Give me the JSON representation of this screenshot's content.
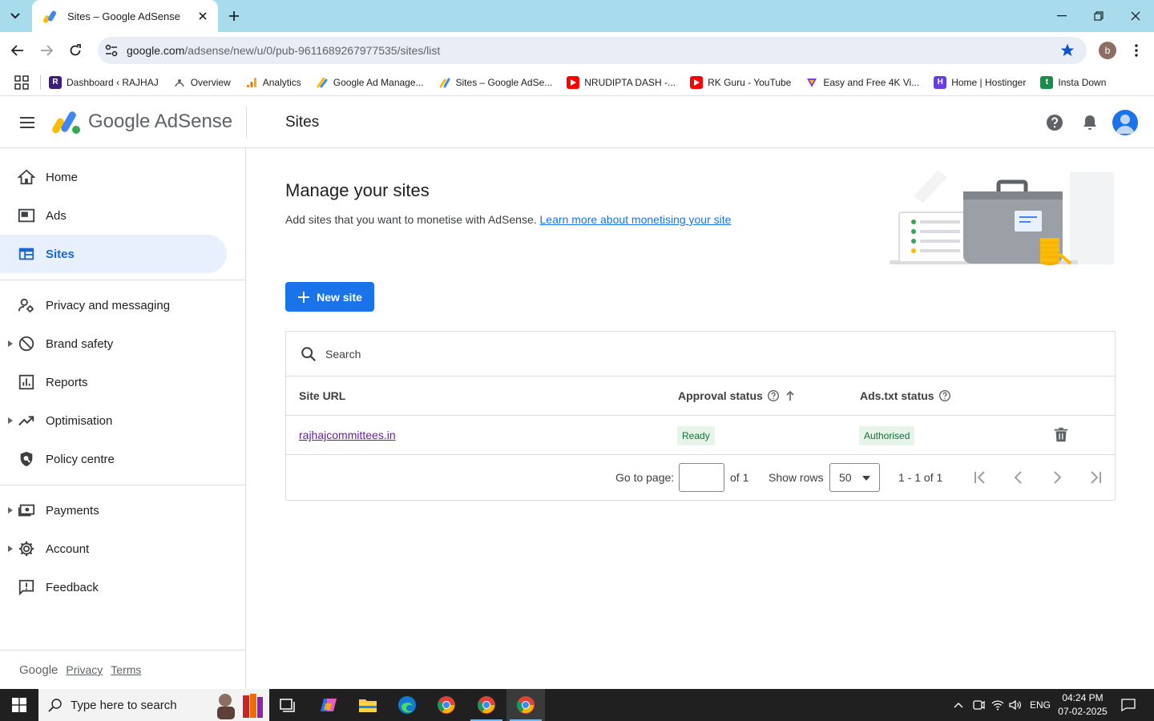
{
  "browser": {
    "tab_title": "Sites – Google AdSense",
    "url_host": "google.com",
    "url_path": "/adsense/new/u/0/pub-9611689267977535/sites/list",
    "profile_initial": "b"
  },
  "bookmarks": [
    {
      "label": "Dashboard ‹ RAJHAJ",
      "icon": "site-r-icon",
      "color": "#3c1f7a"
    },
    {
      "label": "Overview",
      "icon": "overview-icon",
      "color": "#5f6368"
    },
    {
      "label": "Analytics",
      "icon": "analytics-icon",
      "color": "#f9ab00"
    },
    {
      "label": "Google Ad Manage...",
      "icon": "ad-manager-icon",
      "color": "#fbbc04"
    },
    {
      "label": "Sites – Google AdSe...",
      "icon": "adsense-icon",
      "color": "#4285f4"
    },
    {
      "label": "NRUDIPTA DASH -...",
      "icon": "youtube-icon",
      "color": "#ff0000"
    },
    {
      "label": "RK Guru - YouTube",
      "icon": "youtube-icon",
      "color": "#ff0000"
    },
    {
      "label": "Easy and Free 4K Vi...",
      "icon": "vimeo-like-icon",
      "color": "#7b3fe4"
    },
    {
      "label": "Home | Hostinger",
      "icon": "hostinger-icon",
      "color": "#673de6"
    },
    {
      "label": "Insta Down",
      "icon": "insta-down-icon",
      "color": "#1b8a4c"
    }
  ],
  "header": {
    "product": "Google AdSense",
    "page_title": "Sites"
  },
  "sidebar": {
    "items": [
      {
        "label": "Home",
        "icon": "home-icon"
      },
      {
        "label": "Ads",
        "icon": "ads-icon"
      },
      {
        "label": "Sites",
        "icon": "sites-icon"
      },
      {
        "label": "Privacy and messaging",
        "icon": "privacy-icon"
      },
      {
        "label": "Brand safety",
        "icon": "block-icon"
      },
      {
        "label": "Reports",
        "icon": "reports-icon"
      },
      {
        "label": "Optimisation",
        "icon": "trending-icon"
      },
      {
        "label": "Policy centre",
        "icon": "policy-icon"
      },
      {
        "label": "Payments",
        "icon": "payments-icon"
      },
      {
        "label": "Account",
        "icon": "gear-icon"
      },
      {
        "label": "Feedback",
        "icon": "feedback-icon"
      }
    ],
    "footer": {
      "brand": "Google",
      "privacy": "Privacy",
      "terms": "Terms"
    }
  },
  "main": {
    "title": "Manage your sites",
    "description": "Add sites that you want to monetise with AdSense. ",
    "learn_more": "Learn more about monetising your site",
    "new_site_label": "New site",
    "search_placeholder": "Search",
    "columns": {
      "site_url": "Site URL",
      "approval": "Approval status",
      "ads_txt": "Ads.txt status"
    },
    "rows": [
      {
        "site": "rajhajcommittees.in",
        "approval": "Ready",
        "ads_txt": "Authorised"
      }
    ],
    "pager": {
      "go_to_page": "Go to page:",
      "of_pages": "of 1",
      "show_rows": "Show rows",
      "rows_value": "50",
      "range": "1 - 1 of 1"
    }
  },
  "taskbar": {
    "search_placeholder": "Type here to search",
    "lang": "ENG",
    "time": "04:24 PM",
    "date": "07-02-2025"
  },
  "colors": {
    "accent": "#1a73e8",
    "active_nav_bg": "#e8f0fe",
    "status_green": "#137333",
    "tabstrip": "#a8dcec"
  }
}
